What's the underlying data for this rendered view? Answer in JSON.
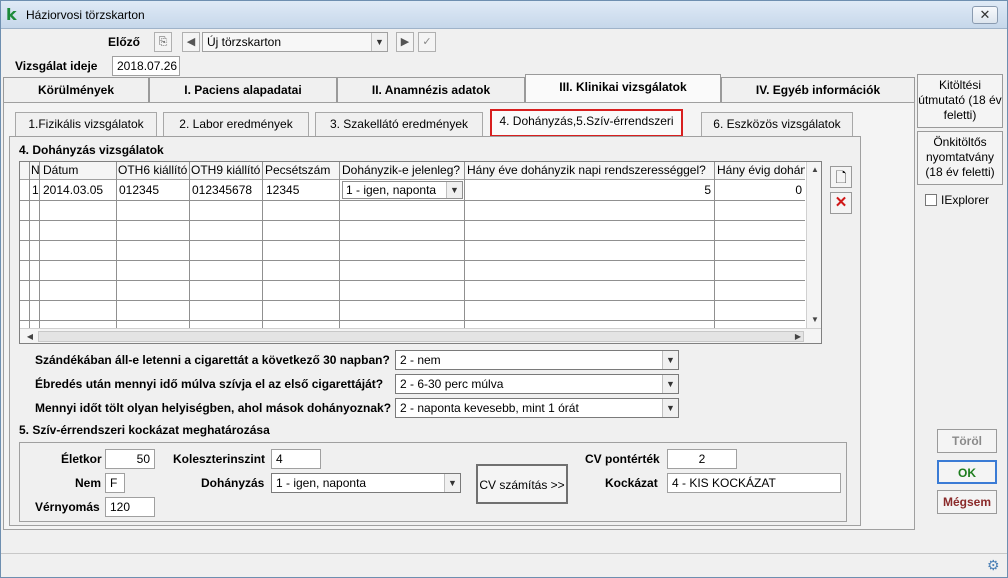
{
  "window": {
    "title": "Háziorvosi törzskarton",
    "close_symbol": "✕",
    "app_icon": "k"
  },
  "header": {
    "previous_label": "Előző",
    "record_select_value": "Új törzskarton",
    "exam_date_label": "Vizsgálat ideje",
    "exam_date_value": "2018.07.26"
  },
  "main_tabs": [
    {
      "label": "Körülmények"
    },
    {
      "label": "I. Paciens alapadatai"
    },
    {
      "label": "II. Anamnézis adatok"
    },
    {
      "label": "III. Klinikai vizsgálatok"
    },
    {
      "label": "IV. Egyéb információk"
    }
  ],
  "sub_tabs": [
    {
      "label": "1.Fizikális vizsgálatok"
    },
    {
      "label": "2. Labor eredmények"
    },
    {
      "label": "3. Szakellátó eredmények"
    },
    {
      "label": "4. Dohányzás,5.Szív-érrendszeri"
    },
    {
      "label": "6. Eszközös vizsgálatok"
    }
  ],
  "smoking_section": {
    "title": "4. Dohányzás vizsgálatok",
    "columns": [
      "N",
      "Dátum",
      "OTH6 kiállító",
      "OTH9 kiállító",
      "Pecsétszám",
      "Dohányzik-e jelenleg?",
      "Hány éve dohányzik napi rendszerességgel?",
      "Hány évig dohán"
    ],
    "rows": [
      {
        "n": "1",
        "date": "2014.03.05",
        "oth6": "012345",
        "oth9": "012345678",
        "stamp": "12345",
        "smokes": "1 - igen, naponta",
        "years_daily": "5",
        "years_smoked": "0"
      }
    ]
  },
  "questions": [
    {
      "label": "Szándékában áll-e letenni a cigarettát a következő 30 napban?",
      "value": "2 - nem"
    },
    {
      "label": "Ébredés után mennyi idő múlva szívja el az első cigarettáját?",
      "value": "2 - 6-30 perc múlva"
    },
    {
      "label": "Mennyi időt tölt olyan helyiségben, ahol mások dohányoznak?",
      "value": "2 - naponta kevesebb, mint 1 órát"
    }
  ],
  "cv_section": {
    "title": "5. Szív-érrendszeri kockázat meghatározása",
    "age_label": "Életkor",
    "age_value": "50",
    "sex_label": "Nem",
    "sex_value": "F",
    "bp_label": "Vérnyomás",
    "bp_value": "120",
    "chol_label": "Koleszterinszint",
    "chol_value": "4",
    "smoking_label": "Dohányzás",
    "smoking_value": "1 - igen, naponta",
    "calc_button": "CV számítás >>",
    "score_label": "CV pontérték",
    "score_value": "2",
    "risk_label": "Kockázat",
    "risk_value": "4 - KIS KOCKÁZAT"
  },
  "sidebar": {
    "guide_button": "Kitöltési útmutató (18 év feletti)",
    "form_button": "Önkitöltős nyomtatvány (18 év feletti)",
    "iexplorer_label": "IExplorer",
    "iexplorer_checked": false
  },
  "actions": {
    "delete": "Töröl",
    "ok": "OK",
    "cancel": "Mégsem"
  },
  "colors": {
    "highlight": "#d81f1f",
    "ok_text": "#1e7d1e",
    "cancel_text": "#8a2a2a",
    "delete_text": "#8a8a8a"
  }
}
